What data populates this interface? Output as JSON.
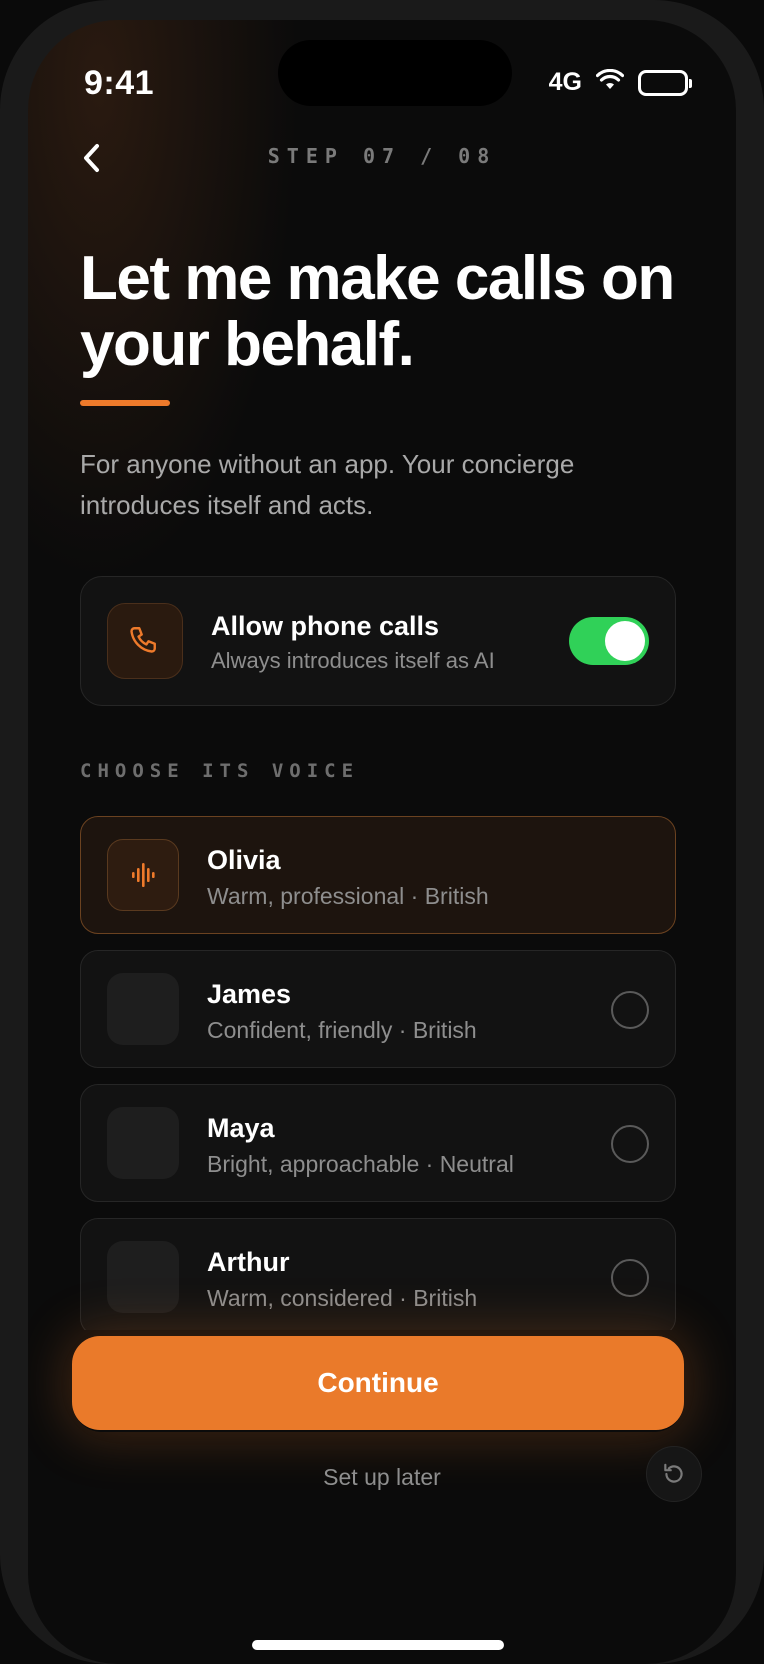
{
  "status_bar": {
    "time": "9:41",
    "network": "4G",
    "battery_level": 1.0
  },
  "header": {
    "step_label": "STEP 07 / 08",
    "back_icon": "chevron-left-icon"
  },
  "intro": {
    "title": "Let me make calls on your behalf.",
    "subtitle": "For anyone without an app. Your concierge introduces itself and acts."
  },
  "phone_calls": {
    "icon": "phone-icon",
    "title": "Allow phone calls",
    "subtitle": "Always introduces itself as AI",
    "enabled": true
  },
  "voice_section": {
    "label": "CHOOSE ITS VOICE",
    "voices": [
      {
        "name": "Olivia",
        "description": "Warm, professional · British",
        "selected": true
      },
      {
        "name": "James",
        "description": "Confident, friendly · British",
        "selected": false
      },
      {
        "name": "Maya",
        "description": "Bright, approachable · Neutral",
        "selected": false
      },
      {
        "name": "Arthur",
        "description": "Warm, considered · British",
        "selected": false
      }
    ]
  },
  "footer": {
    "continue_label": "Continue",
    "later_label": "Set up later",
    "replay_icon": "replay-icon"
  },
  "colors": {
    "accent": "#ea7a2a",
    "toggle_on": "#30d158",
    "background": "#0b0b0b"
  }
}
